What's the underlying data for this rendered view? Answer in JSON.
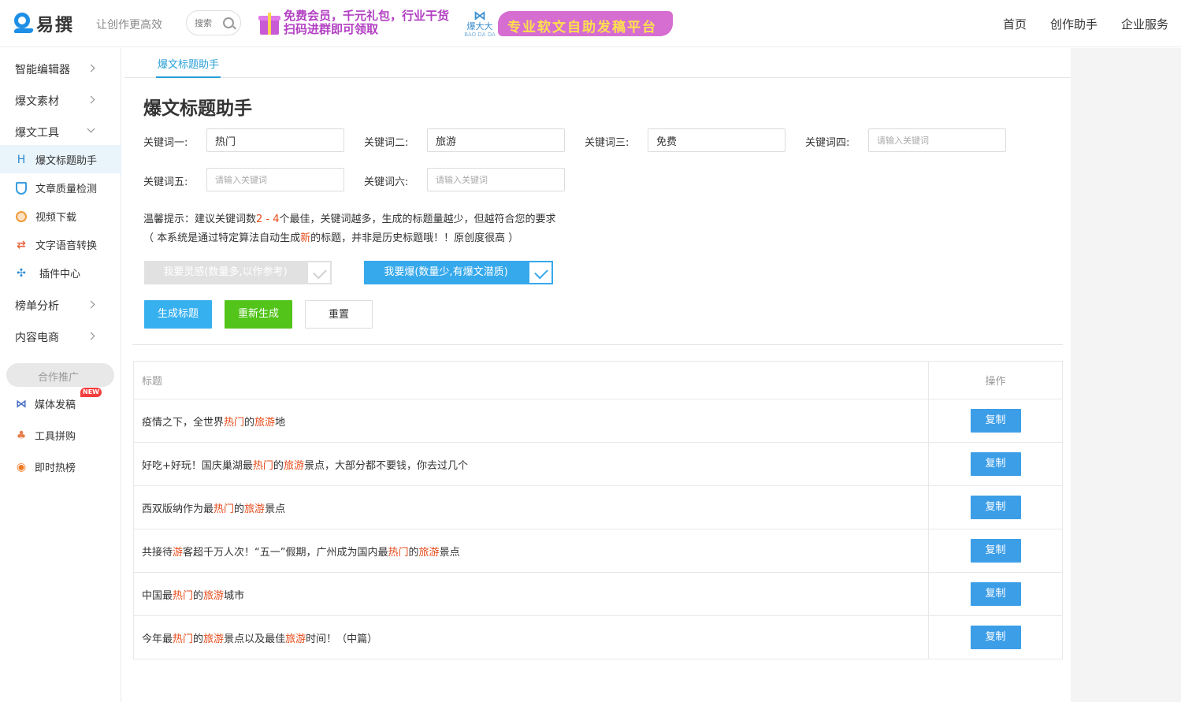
{
  "header": {
    "logo_text": "易撰",
    "slogan": "让创作更高效",
    "search_placeholder": "搜索",
    "promo_lines": [
      "免费会员，千元礼包，行业干货",
      "扫码进群即可领取"
    ],
    "bdd_mark": "⋈",
    "bdd_name": "爆大大",
    "bdd_sub": "BAO DA DA",
    "bdd_banner": "专业软文自助发稿平台",
    "nav": [
      "首页",
      "创作助手",
      "企业服务"
    ]
  },
  "sidebar": {
    "groups": [
      "智能编辑器",
      "爆文素材",
      "爆文工具"
    ],
    "tool_items": [
      "爆文标题助手",
      "文章质量检测",
      "视频下载",
      "文字语音转换",
      "插件中心"
    ],
    "more_groups": [
      "榜单分析",
      "内容电商"
    ],
    "coop_label": "合作推广",
    "coop_items": [
      "媒体发稿",
      "工具拼购",
      "即时热榜"
    ],
    "new_badge": "NEW",
    "icon_names": [
      "h-icon",
      "shield-icon",
      "video-icon",
      "convert-icon",
      "plugin-icon",
      "media-icon",
      "tools-icon",
      "hot-icon"
    ]
  },
  "main": {
    "tab": "爆文标题助手",
    "title": "爆文标题助手",
    "keywords": [
      {
        "label": "关键词一:",
        "value": "热门",
        "placeholder": "请输入关键词"
      },
      {
        "label": "关键词二:",
        "value": "旅游",
        "placeholder": "请输入关键词"
      },
      {
        "label": "关键词三:",
        "value": "免费",
        "placeholder": "请输入关键词"
      },
      {
        "label": "关键词四:",
        "value": "",
        "placeholder": "请输入关键词"
      },
      {
        "label": "关键词五:",
        "value": "",
        "placeholder": "请输入关键词"
      },
      {
        "label": "关键词六:",
        "value": "",
        "placeholder": "请输入关键词"
      }
    ],
    "tip1": {
      "a": "温馨提示：建议关键词数",
      "b": "2 - 4",
      "c": "个最佳，关键词越多，生成的标题量越少，但越符合您的要求"
    },
    "tip2": {
      "a": "（ 本系统是通过特定算法自动生成",
      "b": "新",
      "c": "的标题，并非是历史标题哦！！原创度很高 ）"
    },
    "mode_inspire": "我要灵感(数量多,以作参考)",
    "mode_burst": "我要爆(数量少,有爆文潜质)",
    "btn_generate": "生成标题",
    "btn_regenerate": "重新生成",
    "btn_reset": "重置",
    "table": {
      "col_title": "标题",
      "col_op": "操作",
      "copy_label": "复制",
      "rows": [
        [
          [
            "疫情之下，全世界",
            false
          ],
          [
            "热门",
            true
          ],
          [
            "的",
            false
          ],
          [
            "旅游",
            true
          ],
          [
            "地",
            false
          ]
        ],
        [
          [
            "好吃+好玩！国庆巢湖最",
            false
          ],
          [
            "热门",
            true
          ],
          [
            "的",
            false
          ],
          [
            "旅游",
            true
          ],
          [
            "景点，大部分都不要钱，你去过几个",
            false
          ]
        ],
        [
          [
            "西双版纳作为最",
            false
          ],
          [
            "热门",
            true
          ],
          [
            "的",
            false
          ],
          [
            "旅游",
            true
          ],
          [
            "景点",
            false
          ]
        ],
        [
          [
            "共接待",
            false
          ],
          [
            "游",
            true
          ],
          [
            "客超千万人次！“五一”假期，广州成为国内最",
            false
          ],
          [
            "热门",
            true
          ],
          [
            "的",
            false
          ],
          [
            "旅游",
            true
          ],
          [
            "景点",
            false
          ]
        ],
        [
          [
            "中国最",
            false
          ],
          [
            "热门",
            true
          ],
          [
            "的",
            false
          ],
          [
            "旅游",
            true
          ],
          [
            "城市",
            false
          ]
        ],
        [
          [
            "今年最",
            false
          ],
          [
            "热门",
            true
          ],
          [
            "的",
            false
          ],
          [
            "旅游",
            true
          ],
          [
            "景点以及最佳",
            false
          ],
          [
            "旅游",
            true
          ],
          [
            "时间！（中篇）",
            false
          ]
        ]
      ]
    }
  },
  "colors": {
    "accent": "#2a9fd8",
    "highlight": "#e64a19",
    "green": "#52c41a",
    "copy": "#3d9ee8"
  }
}
